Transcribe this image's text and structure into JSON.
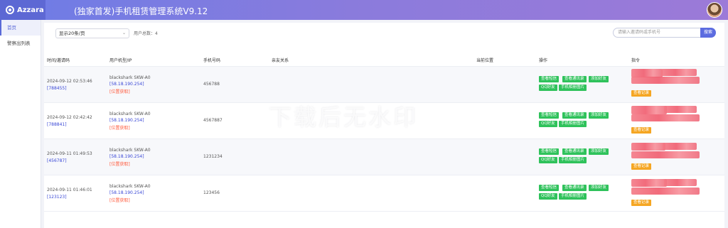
{
  "brand": {
    "name": "Azzara"
  },
  "header": {
    "title": "(独家首发)手机租赁管理系统V9.12"
  },
  "sidebar": {
    "items": [
      {
        "label": "首页"
      },
      {
        "label": "警察出列表"
      }
    ]
  },
  "toolbar": {
    "page_size": "显示20条/页",
    "user_count": "用户总数：4",
    "search_placeholder": "请输入邀请码或手机号",
    "search_button": "搜索"
  },
  "table": {
    "headers": {
      "time": "时间/邀请码",
      "device": "用户机型/IP",
      "phone": "手机号码",
      "relation": "亲友关系",
      "location": "当前位置",
      "ops": "操作",
      "command": "指令"
    },
    "buttons": {
      "view_sms": "查看短信",
      "view_contacts": "查看通讯录",
      "add_friend": "添加好友",
      "qq_friend": "QQ好友",
      "phone_album": "手机相册图片",
      "view_record": "查看记录"
    },
    "rows": [
      {
        "time": "2024-09-12 02:53:46",
        "code": "[788455]",
        "model": "blackshark SKW-A0",
        "ip": "[58.18.190.254]",
        "loc": "[位置获取]",
        "phone": "456788"
      },
      {
        "time": "2024-09-12 02:42:42",
        "code": "[788841]",
        "model": "blackshark SKW-A0",
        "ip": "[58.18.190.254]",
        "loc": "[位置获取]",
        "phone": "4567887"
      },
      {
        "time": "2024-09-11 01:49:53",
        "code": "[456787]",
        "model": "blackshark SKW-A0",
        "ip": "[58.18.190.254]",
        "loc": "[位置获取]",
        "phone": "1231234"
      },
      {
        "time": "2024-09-11 01:46:01",
        "code": "[123123]",
        "model": "blackshark SKW-A0",
        "ip": "[58.18.190.254]",
        "loc": "[位置获取]",
        "phone": "123456"
      }
    ]
  },
  "watermark": "下载后无水印"
}
